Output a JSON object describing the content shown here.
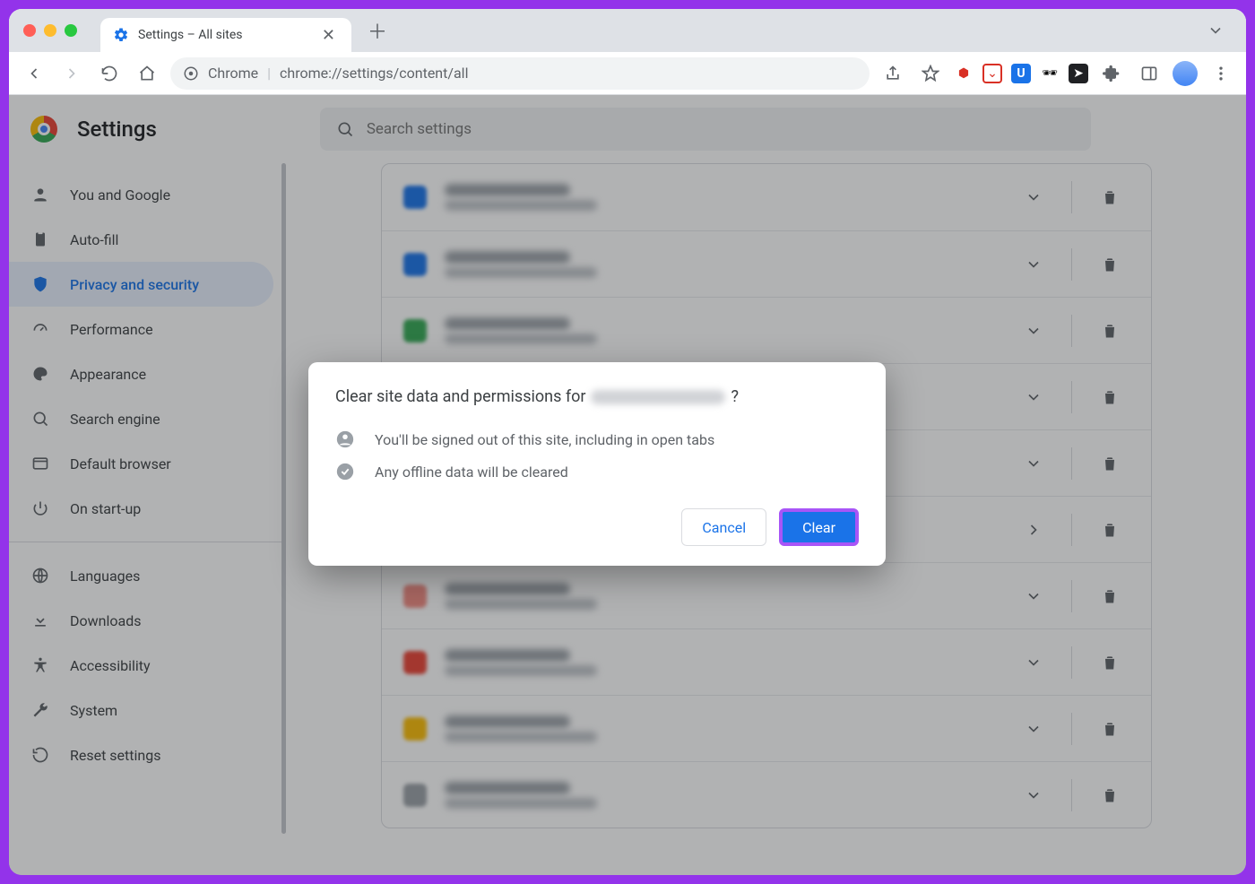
{
  "tab": {
    "title": "Settings – All sites"
  },
  "omnibox": {
    "prefix": "Chrome",
    "url": "chrome://settings/content/all"
  },
  "settings": {
    "title": "Settings",
    "search_placeholder": "Search settings"
  },
  "sidebar": {
    "items": [
      {
        "label": "You and Google"
      },
      {
        "label": "Auto-fill"
      },
      {
        "label": "Privacy and security"
      },
      {
        "label": "Performance"
      },
      {
        "label": "Appearance"
      },
      {
        "label": "Search engine"
      },
      {
        "label": "Default browser"
      },
      {
        "label": "On start-up"
      }
    ],
    "extras": [
      {
        "label": "Languages"
      },
      {
        "label": "Downloads"
      },
      {
        "label": "Accessibility"
      },
      {
        "label": "System"
      },
      {
        "label": "Reset settings"
      }
    ]
  },
  "dialog": {
    "title_prefix": "Clear site data and permissions for ",
    "title_suffix": "?",
    "line1": "You'll be signed out of this site, including in open tabs",
    "line2": "Any offline data will be cleared",
    "cancel": "Cancel",
    "clear": "Clear"
  },
  "site_colors": [
    "#1a73e8",
    "#1a73e8",
    "#34a853",
    "#fbbc05",
    "#9aa0a6",
    "#ea4335",
    "#f28b82",
    "#ea4335",
    "#fbbc05",
    "#9aa0a6"
  ]
}
